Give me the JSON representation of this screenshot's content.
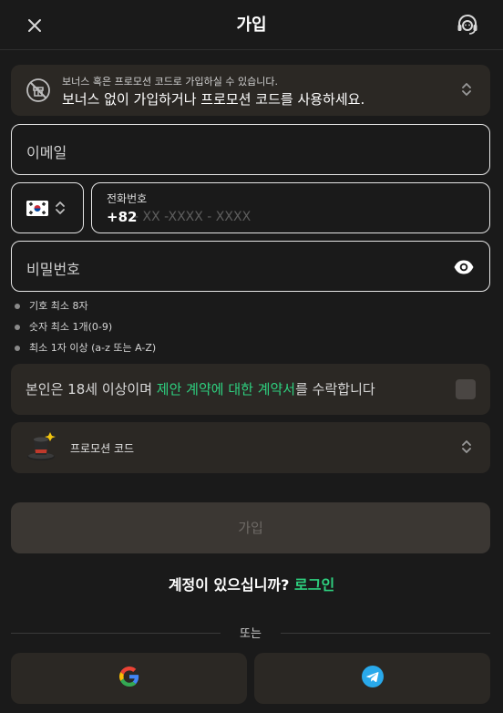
{
  "header": {
    "title": "가입",
    "close_icon": "close-icon",
    "support_icon": "headset-support-icon"
  },
  "bonus": {
    "icon": "no-bonus-icon",
    "subtitle": "보너스 혹은 프로모션 코드로 가입하실 수 있습니다.",
    "title": "보너스 없이 가입하거나 프로모션 코드를 사용하세요."
  },
  "form": {
    "email_placeholder": "이메일",
    "country_flag": "south-korea-flag",
    "phone_label": "전화번호",
    "phone_code": "+82",
    "phone_placeholder": "- XX -XXXX - XXXX",
    "password_placeholder": "비밀번호"
  },
  "password_rules": [
    "기호 최소 8자",
    "숫자 최소 1개(0-9)",
    "최소 1자 이상 (a-z 또는 A-Z)"
  ],
  "terms": {
    "prefix": "본인은 18세 이상이며 ",
    "link": "제안 계약에 대한 계약서",
    "suffix": "를 수락합니다",
    "checked": false
  },
  "promo": {
    "icon": "magic-hat-icon",
    "label": "프로모션 코드"
  },
  "signup_button": "가입",
  "login_prompt": {
    "question": "계정이 있으십니까? ",
    "link": "로그인"
  },
  "divider_text": "또는",
  "social": {
    "google_icon": "google-icon",
    "telegram_icon": "telegram-icon"
  },
  "colors": {
    "background": "#1a1a1a",
    "panel": "#2b2824",
    "accent": "#2ed07f",
    "disabled_button": "#3b3733"
  }
}
